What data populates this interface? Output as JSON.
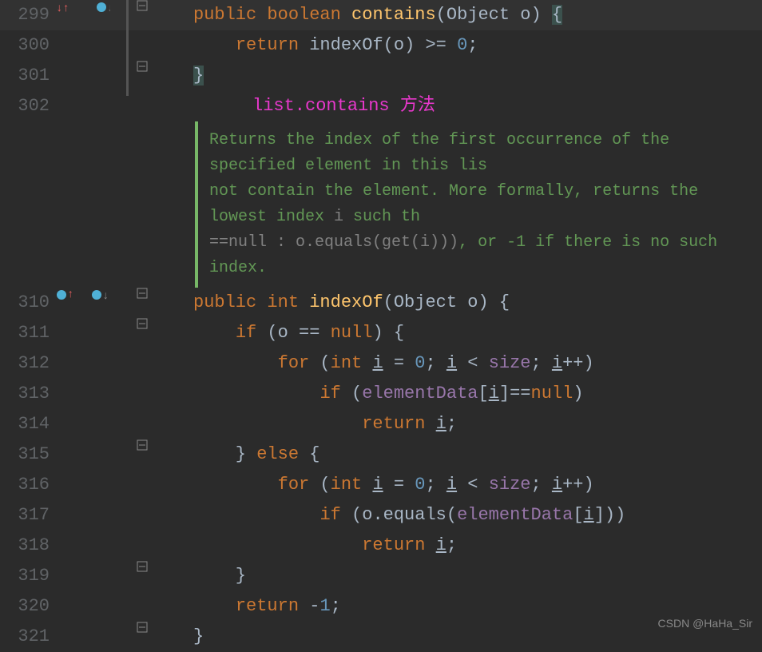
{
  "watermark": "CSDN @HaHa_Sir",
  "annotation": "list.contains 方法",
  "javadoc": {
    "l1": "Returns the index of the first occurrence of the specified element in this lis",
    "l2a": "not contain the element. More formally, returns the lowest index ",
    "l2b": "i",
    "l2c": " such th",
    "l3a": "==null  :  o.equals(get(i)))",
    "l3b": ", or -1 if there is no such index."
  },
  "lines": {
    "299": "299",
    "300": "300",
    "301": "301",
    "302": "302",
    "310": "310",
    "311": "311",
    "312": "312",
    "313": "313",
    "314": "314",
    "315": "315",
    "316": "316",
    "317": "317",
    "318": "318",
    "319": "319",
    "320": "320",
    "321": "321"
  },
  "tokens": {
    "public": "public",
    "boolean": "boolean",
    "int_kw": "int",
    "contains": "contains",
    "indexOf": "indexOf",
    "Object": "Object",
    "o": "o",
    "return": "return",
    "zero": "0",
    "ge": ">=",
    "if": "if",
    "else": "else",
    "for": "for",
    "null": "null",
    "i": "i",
    "size": "size",
    "elementData": "elementData",
    "equals": "equals",
    "neg1": "-",
    "one": "1",
    "eqeq": "==",
    "lt": "<",
    "pp": "++",
    "eq": "="
  }
}
